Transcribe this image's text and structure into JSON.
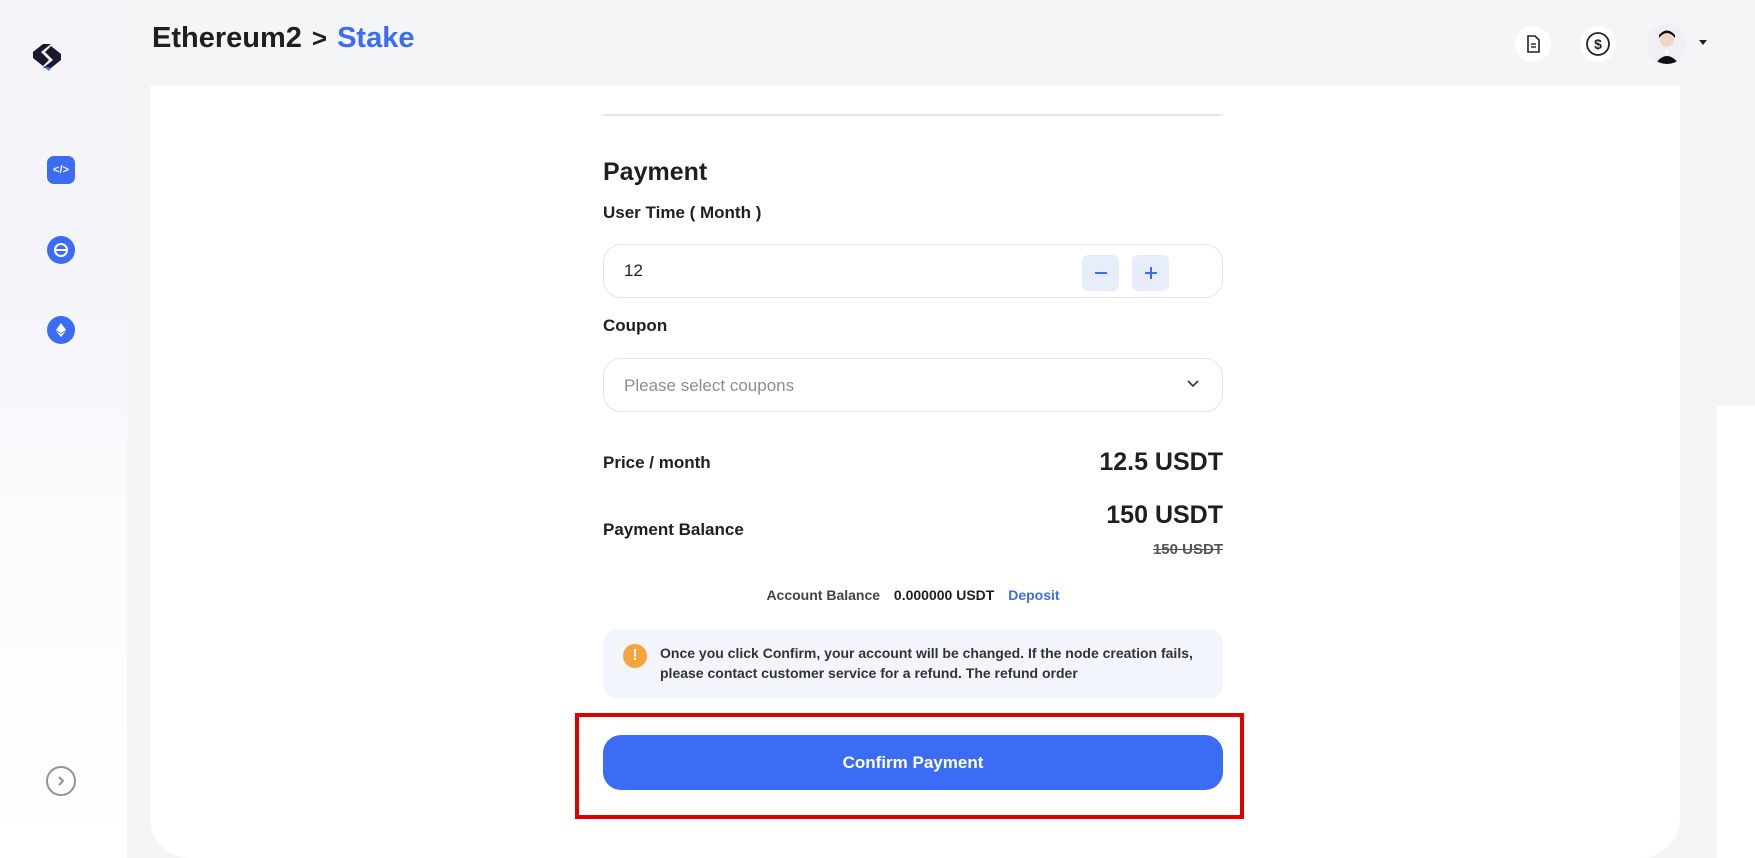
{
  "breadcrumb": {
    "parent": "Ethereum2",
    "separator": ">",
    "current": "Stake"
  },
  "payment": {
    "title": "Payment",
    "user_time_label": "User Time ( Month )",
    "user_time_value": "12",
    "coupon_label": "Coupon",
    "coupon_placeholder": "Please select coupons",
    "price_label": "Price / month",
    "price_value": "12.5 USDT",
    "balance_label": "Payment Balance",
    "balance_value": "150 USDT",
    "balance_original": "150 USDT"
  },
  "account": {
    "label": "Account Balance",
    "value": "0.000000 USDT",
    "deposit": "Deposit"
  },
  "notice": "Once you click Confirm, your account will be changed. If the node creation fails, please contact customer service for a refund. The refund order",
  "confirm_label": "Confirm Payment",
  "colors": {
    "accent": "#3b6cf6",
    "warning": "#f5a33c",
    "highlight": "#e00000"
  }
}
